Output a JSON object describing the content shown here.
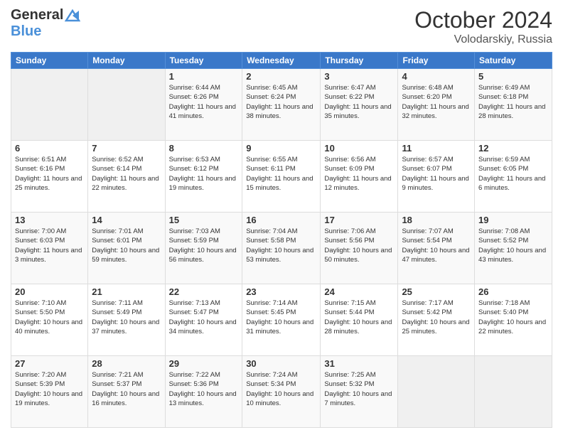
{
  "header": {
    "logo_general": "General",
    "logo_blue": "Blue",
    "month_title": "October 2024",
    "subtitle": "Volodarskiy, Russia"
  },
  "days_of_week": [
    "Sunday",
    "Monday",
    "Tuesday",
    "Wednesday",
    "Thursday",
    "Friday",
    "Saturday"
  ],
  "weeks": [
    [
      {
        "day": "",
        "info": ""
      },
      {
        "day": "",
        "info": ""
      },
      {
        "day": "1",
        "info": "Sunrise: 6:44 AM\nSunset: 6:26 PM\nDaylight: 11 hours and 41 minutes."
      },
      {
        "day": "2",
        "info": "Sunrise: 6:45 AM\nSunset: 6:24 PM\nDaylight: 11 hours and 38 minutes."
      },
      {
        "day": "3",
        "info": "Sunrise: 6:47 AM\nSunset: 6:22 PM\nDaylight: 11 hours and 35 minutes."
      },
      {
        "day": "4",
        "info": "Sunrise: 6:48 AM\nSunset: 6:20 PM\nDaylight: 11 hours and 32 minutes."
      },
      {
        "day": "5",
        "info": "Sunrise: 6:49 AM\nSunset: 6:18 PM\nDaylight: 11 hours and 28 minutes."
      }
    ],
    [
      {
        "day": "6",
        "info": "Sunrise: 6:51 AM\nSunset: 6:16 PM\nDaylight: 11 hours and 25 minutes."
      },
      {
        "day": "7",
        "info": "Sunrise: 6:52 AM\nSunset: 6:14 PM\nDaylight: 11 hours and 22 minutes."
      },
      {
        "day": "8",
        "info": "Sunrise: 6:53 AM\nSunset: 6:12 PM\nDaylight: 11 hours and 19 minutes."
      },
      {
        "day": "9",
        "info": "Sunrise: 6:55 AM\nSunset: 6:11 PM\nDaylight: 11 hours and 15 minutes."
      },
      {
        "day": "10",
        "info": "Sunrise: 6:56 AM\nSunset: 6:09 PM\nDaylight: 11 hours and 12 minutes."
      },
      {
        "day": "11",
        "info": "Sunrise: 6:57 AM\nSunset: 6:07 PM\nDaylight: 11 hours and 9 minutes."
      },
      {
        "day": "12",
        "info": "Sunrise: 6:59 AM\nSunset: 6:05 PM\nDaylight: 11 hours and 6 minutes."
      }
    ],
    [
      {
        "day": "13",
        "info": "Sunrise: 7:00 AM\nSunset: 6:03 PM\nDaylight: 11 hours and 3 minutes."
      },
      {
        "day": "14",
        "info": "Sunrise: 7:01 AM\nSunset: 6:01 PM\nDaylight: 10 hours and 59 minutes."
      },
      {
        "day": "15",
        "info": "Sunrise: 7:03 AM\nSunset: 5:59 PM\nDaylight: 10 hours and 56 minutes."
      },
      {
        "day": "16",
        "info": "Sunrise: 7:04 AM\nSunset: 5:58 PM\nDaylight: 10 hours and 53 minutes."
      },
      {
        "day": "17",
        "info": "Sunrise: 7:06 AM\nSunset: 5:56 PM\nDaylight: 10 hours and 50 minutes."
      },
      {
        "day": "18",
        "info": "Sunrise: 7:07 AM\nSunset: 5:54 PM\nDaylight: 10 hours and 47 minutes."
      },
      {
        "day": "19",
        "info": "Sunrise: 7:08 AM\nSunset: 5:52 PM\nDaylight: 10 hours and 43 minutes."
      }
    ],
    [
      {
        "day": "20",
        "info": "Sunrise: 7:10 AM\nSunset: 5:50 PM\nDaylight: 10 hours and 40 minutes."
      },
      {
        "day": "21",
        "info": "Sunrise: 7:11 AM\nSunset: 5:49 PM\nDaylight: 10 hours and 37 minutes."
      },
      {
        "day": "22",
        "info": "Sunrise: 7:13 AM\nSunset: 5:47 PM\nDaylight: 10 hours and 34 minutes."
      },
      {
        "day": "23",
        "info": "Sunrise: 7:14 AM\nSunset: 5:45 PM\nDaylight: 10 hours and 31 minutes."
      },
      {
        "day": "24",
        "info": "Sunrise: 7:15 AM\nSunset: 5:44 PM\nDaylight: 10 hours and 28 minutes."
      },
      {
        "day": "25",
        "info": "Sunrise: 7:17 AM\nSunset: 5:42 PM\nDaylight: 10 hours and 25 minutes."
      },
      {
        "day": "26",
        "info": "Sunrise: 7:18 AM\nSunset: 5:40 PM\nDaylight: 10 hours and 22 minutes."
      }
    ],
    [
      {
        "day": "27",
        "info": "Sunrise: 7:20 AM\nSunset: 5:39 PM\nDaylight: 10 hours and 19 minutes."
      },
      {
        "day": "28",
        "info": "Sunrise: 7:21 AM\nSunset: 5:37 PM\nDaylight: 10 hours and 16 minutes."
      },
      {
        "day": "29",
        "info": "Sunrise: 7:22 AM\nSunset: 5:36 PM\nDaylight: 10 hours and 13 minutes."
      },
      {
        "day": "30",
        "info": "Sunrise: 7:24 AM\nSunset: 5:34 PM\nDaylight: 10 hours and 10 minutes."
      },
      {
        "day": "31",
        "info": "Sunrise: 7:25 AM\nSunset: 5:32 PM\nDaylight: 10 hours and 7 minutes."
      },
      {
        "day": "",
        "info": ""
      },
      {
        "day": "",
        "info": ""
      }
    ]
  ]
}
